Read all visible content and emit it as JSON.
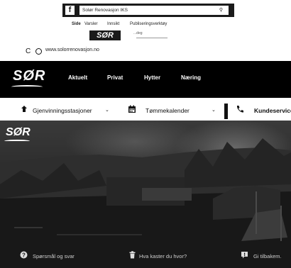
{
  "facebook": {
    "search_value": "Solør Renovasjon IKS",
    "logo_glyph": "f",
    "tabs": [
      "Side",
      "Varsler",
      "Innsikt",
      "Publiseringsverktøy"
    ],
    "sub_label": "SØR",
    "sub_small_text": "...deg"
  },
  "browser": {
    "url": "www.solorrenovasjon.no"
  },
  "site": {
    "logo": "SØR",
    "nav": [
      "Aktuelt",
      "Privat",
      "Hytter",
      "Næring"
    ],
    "quick_links": [
      {
        "label": "Gjenvinningsstasjoner",
        "icon": "recycle-icon"
      },
      {
        "label": "Tømmekalender",
        "icon": "calendar-icon"
      },
      {
        "label": "Kundeservice",
        "icon": "phone-icon"
      }
    ],
    "hero": {
      "logo": "SØR",
      "bottom_items": [
        {
          "label": "Spørsmål og svar",
          "icon": "question-icon"
        },
        {
          "label": "Hva kaster du hvor?",
          "icon": "trash-icon"
        },
        {
          "label": "Gi tilbakem.",
          "icon": "feedback-icon"
        }
      ]
    }
  },
  "colors": {
    "nav_bg": "#000000",
    "hero_bg": "#1c1c1c",
    "accent": "#111111"
  }
}
